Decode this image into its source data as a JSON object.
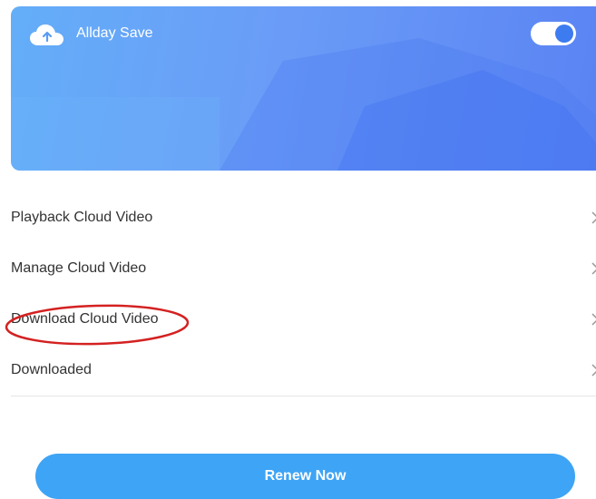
{
  "banner": {
    "icon": "cloud-upload-icon",
    "title": "Allday Save",
    "toggle_on": true,
    "colors": {
      "gradient_start": "#64aef8",
      "gradient_end": "#5a83f3",
      "knob": "#3d7bf0"
    }
  },
  "menu": {
    "items": [
      {
        "label": "Playback Cloud Video",
        "icon": "chevron-right-icon"
      },
      {
        "label": "Manage Cloud Video",
        "icon": "chevron-right-icon"
      },
      {
        "label": "Download Cloud Video",
        "icon": "chevron-right-icon",
        "circled": true
      },
      {
        "label": "Downloaded",
        "icon": "chevron-right-icon"
      }
    ]
  },
  "renew_button": {
    "label": "Renew Now",
    "color": "#3ea4f5"
  },
  "annotation": {
    "color": "#d42121"
  }
}
